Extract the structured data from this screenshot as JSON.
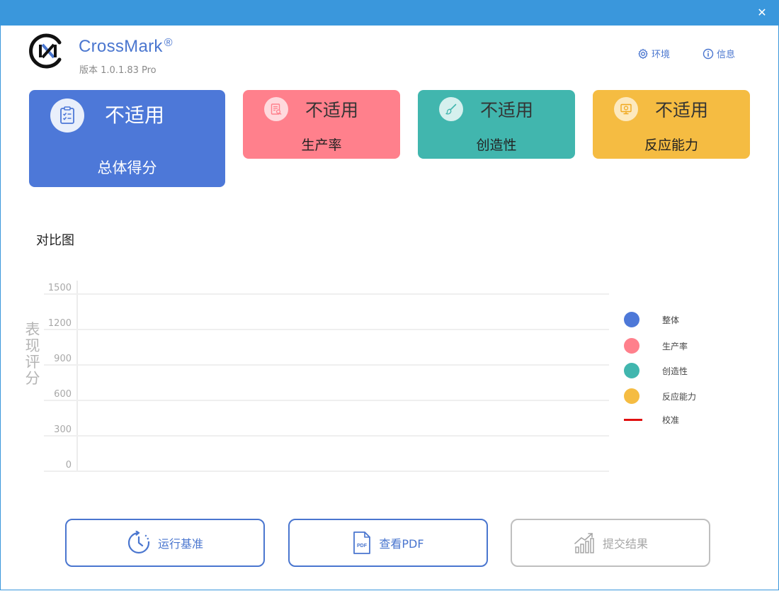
{
  "window": {
    "close_glyph": "✕"
  },
  "header": {
    "app_name": "CrossMark",
    "registered_mark": "®",
    "version": "版本 1.0.1.83 Pro",
    "links": [
      {
        "label": "环境",
        "icon": "gear-icon"
      },
      {
        "label": "信息",
        "icon": "info-icon"
      }
    ]
  },
  "score_cards": [
    {
      "value": "不适用",
      "label": "总体得分",
      "color": "#4d78d8",
      "icon": "clipboard-check-icon"
    },
    {
      "value": "不适用",
      "label": "生产率",
      "color": "#ff808c",
      "icon": "document-search-icon"
    },
    {
      "value": "不适用",
      "label": "创造性",
      "color": "#41b6ae",
      "icon": "paintbrush-icon"
    },
    {
      "value": "不适用",
      "label": "反应能力",
      "color": "#f5bc42",
      "icon": "monitor-icon"
    }
  ],
  "comparison": {
    "title": "对比图"
  },
  "chart_data": {
    "type": "bar",
    "ylabel": "表现评分",
    "ylim": [
      0,
      1500
    ],
    "yticks": [
      "1500",
      "1200",
      "900",
      "600",
      "300",
      "0"
    ],
    "grid": true,
    "legend_position": "right",
    "series": [
      {
        "name": "整体",
        "color": "#4d78d8",
        "values": []
      },
      {
        "name": "生产率",
        "color": "#ff808c",
        "values": []
      },
      {
        "name": "创造性",
        "color": "#41b6ae",
        "values": []
      },
      {
        "name": "反应能力",
        "color": "#f5bc42",
        "values": []
      }
    ],
    "reference_line": {
      "name": "校准",
      "color": "#e01010"
    }
  },
  "actions": [
    {
      "label": "运行基准",
      "icon": "clock-run-icon",
      "enabled": true
    },
    {
      "label": "查看PDF",
      "icon": "pdf-file-icon",
      "enabled": true
    },
    {
      "label": "提交结果",
      "icon": "bar-chart-up-icon",
      "enabled": false
    }
  ]
}
